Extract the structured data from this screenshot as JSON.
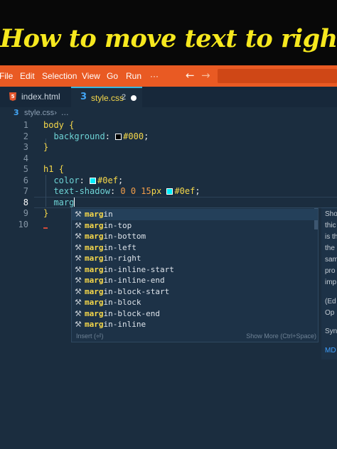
{
  "banner": {
    "title": "How to move text to right"
  },
  "menubar": {
    "items": [
      "File",
      "Edit",
      "Selection",
      "View",
      "Go",
      "Run",
      "···"
    ],
    "back_icon": "arrow-left-icon",
    "forward_icon": "arrow-right-icon"
  },
  "tabs": [
    {
      "label": "index.html",
      "icon": "html5-icon"
    },
    {
      "label": "style.css",
      "icon": "css3-icon",
      "problems": "2",
      "dirty": true
    }
  ],
  "breadcrumb": {
    "file": "style.css",
    "more": "..."
  },
  "editor": {
    "line_numbers": [
      "1",
      "2",
      "3",
      "4",
      "5",
      "6",
      "7",
      "8",
      "9",
      "10"
    ],
    "lines": {
      "l1_selector": "body",
      "l1_brace": "{",
      "l2_prop": "background",
      "l2_colon": ":",
      "l2_val": "#000",
      "l2_semi": ";",
      "l3_brace": "}",
      "l5_selector": "h1",
      "l5_brace": "{",
      "l6_prop": "color",
      "l6_colon": ":",
      "l6_val": "#0ef",
      "l6_semi": ";",
      "l7_prop": "text-shadow",
      "l7_colon": ":",
      "l7_nums": "0 0 15",
      "l7_unit": "px",
      "l7_val": "#0ef",
      "l7_semi": ";",
      "l8_typed": "marg",
      "l9_brace": "}"
    },
    "swatch_colors": {
      "black": "#000000",
      "cyan": "#00eeff"
    }
  },
  "suggest": {
    "match": "marg",
    "items": [
      {
        "rest": "in"
      },
      {
        "rest": "in-top"
      },
      {
        "rest": "in-bottom"
      },
      {
        "rest": "in-left"
      },
      {
        "rest": "in-right"
      },
      {
        "rest": "in-inline-start"
      },
      {
        "rest": "in-inline-end"
      },
      {
        "rest": "in-block-start"
      },
      {
        "rest": "in-block"
      },
      {
        "rest": "in-block-end"
      },
      {
        "rest": "in-inline"
      }
    ],
    "footer_left": "Insert (⏎)",
    "footer_right": "Show More (Ctrl+Space)"
  },
  "details": {
    "lines": [
      "Sho",
      "thic",
      "is th",
      "the",
      "sam",
      "pro",
      "imp",
      "(Ed",
      "Op",
      "Syn",
      "MD"
    ]
  }
}
